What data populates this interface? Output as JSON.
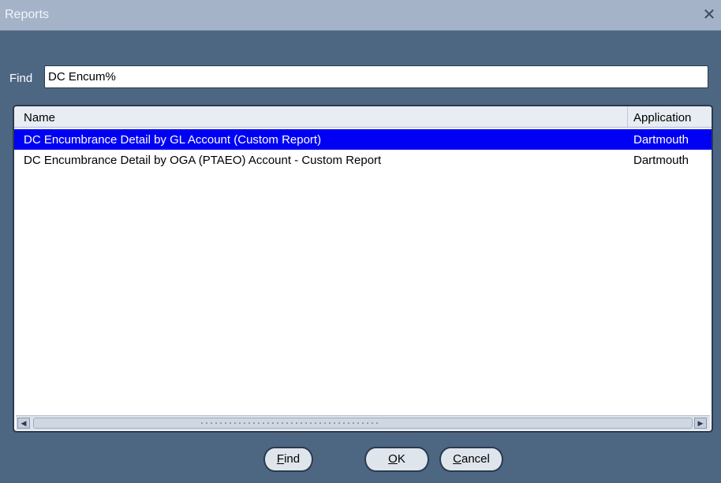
{
  "window": {
    "title": "Reports",
    "close_icon": "close-icon"
  },
  "find": {
    "label": "Find",
    "value": "DC Encum%"
  },
  "list": {
    "columns": [
      "Name",
      "Application"
    ],
    "rows": [
      {
        "name": "DC Encumbrance Detail by GL Account (Custom Report)",
        "application": "Dartmouth",
        "selected": true
      },
      {
        "name": "DC Encumbrance Detail by OGA (PTAEO) Account - Custom Report",
        "application": "Dartmouth",
        "selected": false
      }
    ]
  },
  "scrollbar": {
    "left_icon": "arrow-left-icon",
    "right_icon": "arrow-right-icon"
  },
  "buttons": {
    "find": {
      "mnemonic": "F",
      "rest": "ind"
    },
    "ok": {
      "mnemonic": "O",
      "rest": "K"
    },
    "cancel": {
      "mnemonic": "C",
      "rest": "ancel"
    }
  },
  "colors": {
    "background": "#4d6783",
    "titlebar": "#a4b3c8",
    "selection": "#0000f5"
  }
}
